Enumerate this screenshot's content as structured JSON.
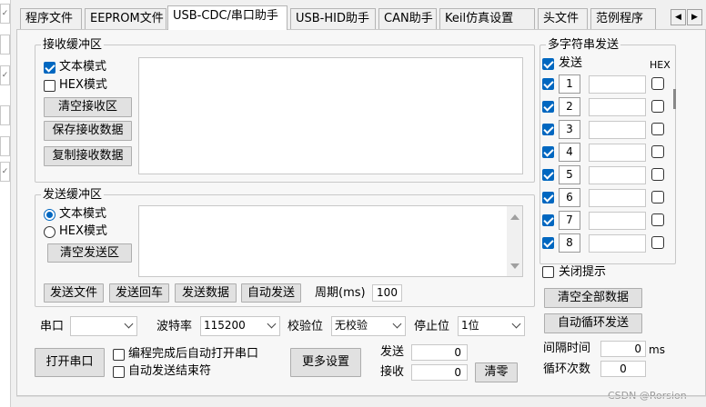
{
  "tabs": [
    "程序文件",
    "EEPROM文件",
    "USB-CDC/串口助手",
    "USB-HID助手",
    "CAN助手",
    "Keil仿真设置",
    "头文件",
    "范例程序"
  ],
  "tab_nav": {
    "prev": "◀",
    "next": "▶"
  },
  "left_strip_marks": [
    "✓",
    "✓",
    "✓"
  ],
  "receive": {
    "legend": "接收缓冲区",
    "text_mode": "文本模式",
    "hex_mode": "HEX模式",
    "clear_btn": "清空接收区",
    "save_btn": "保存接收数据",
    "copy_btn": "复制接收数据"
  },
  "send": {
    "legend": "发送缓冲区",
    "text_mode": "文本模式",
    "hex_mode": "HEX模式",
    "clear_btn": "清空发送区",
    "send_file": "发送文件",
    "send_enter": "发送回车",
    "send_data": "发送数据",
    "auto_send": "自动发送",
    "period_label": "周期(ms)",
    "period_value": "100"
  },
  "serial": {
    "port_label": "串口",
    "port_value": "",
    "baud_label": "波特率",
    "baud_value": "115200",
    "parity_label": "校验位",
    "parity_value": "无校验",
    "stop_label": "停止位",
    "stop_value": "1位",
    "open_btn": "打开串口",
    "auto_open": "编程完成后自动打开串口",
    "auto_end": "自动发送结束符",
    "more_btn": "更多设置",
    "send_label": "发送",
    "send_count": "0",
    "recv_label": "接收",
    "recv_count": "0",
    "clear_btn": "清零"
  },
  "multi": {
    "legend": "多字符串发送",
    "send_header": "发送",
    "hex_header": "HEX",
    "rows": [
      "1",
      "2",
      "3",
      "4",
      "5",
      "6",
      "7",
      "8"
    ],
    "close_tip": "关闭提示",
    "clear_all": "清空全部数据",
    "auto_loop": "自动循环发送",
    "interval_label": "间隔时间",
    "interval_value": "0",
    "interval_unit": "ms",
    "loop_label": "循环次数",
    "loop_value": "0"
  },
  "watermark": "CSDN @Rorsion",
  "colors": {
    "accent": "#0067c0"
  }
}
